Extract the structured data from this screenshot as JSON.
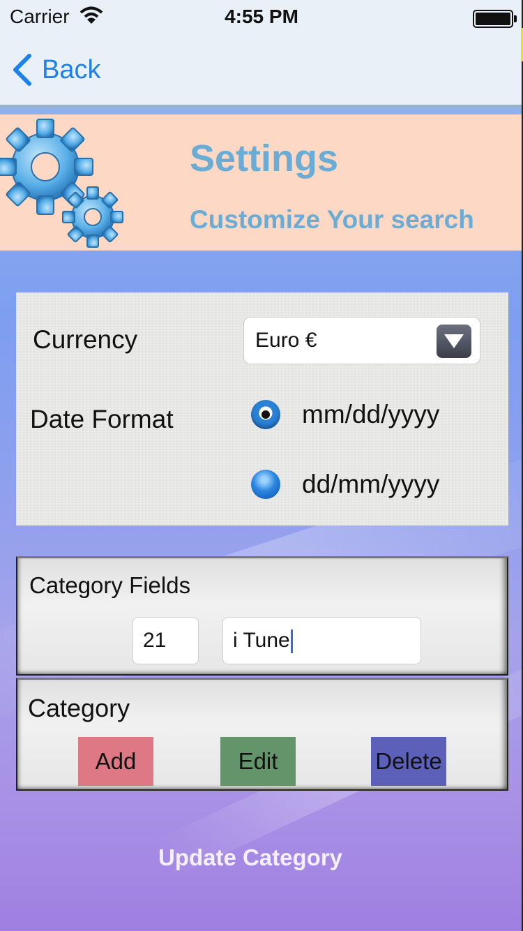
{
  "status_bar": {
    "carrier": "Carrier",
    "time": "4:55 PM"
  },
  "nav": {
    "back_label": "Back"
  },
  "banner": {
    "title": "Settings",
    "subtitle": "Customize Your search"
  },
  "settings": {
    "currency_label": "Currency",
    "currency_value": "Euro €",
    "date_format_label": "Date Format",
    "date_options": [
      {
        "label": "mm/dd/yyyy",
        "selected": true
      },
      {
        "label": "dd/mm/yyyy",
        "selected": false
      }
    ]
  },
  "category_fields": {
    "title": "Category Fields",
    "id_value": "21",
    "name_value": "i Tune"
  },
  "category": {
    "title": "Category",
    "add_label": "Add",
    "edit_label": "Edit",
    "delete_label": "Delete"
  },
  "update_label": "Update Category",
  "colors": {
    "accent": "#1c82ea",
    "banner_bg": "#fcd8c5",
    "banner_text": "#6aacd3",
    "add": "#dd7884",
    "edit": "#64956a",
    "delete": "#5c60b8"
  }
}
